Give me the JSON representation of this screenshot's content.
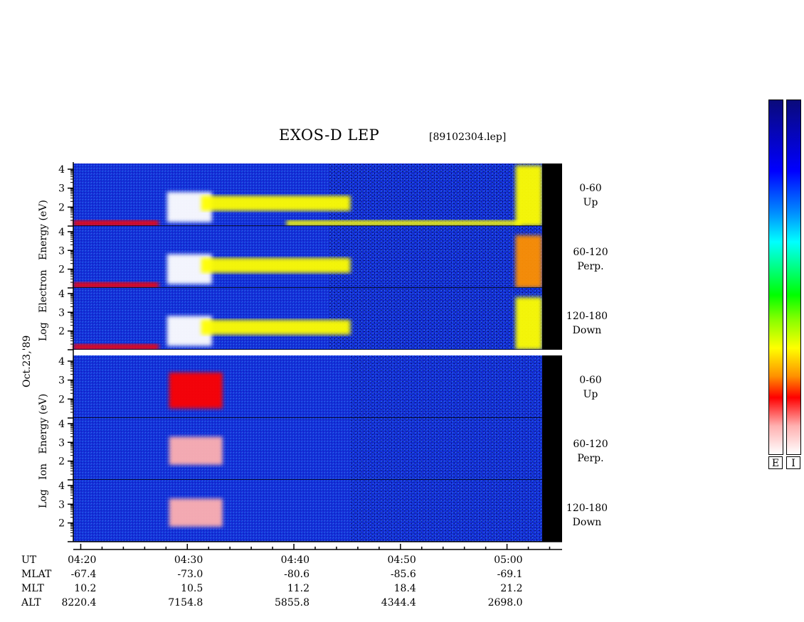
{
  "header": {
    "title": "EXOS-D LEP",
    "file": "[89102304.lep]"
  },
  "y_axis": {
    "date_label": "Oct.23,'89",
    "electron_label": [
      "Log",
      "Electron",
      "Energy",
      "(eV)"
    ],
    "ion_label": [
      "Log",
      "Ion",
      "Energy",
      "(eV)"
    ],
    "ticks": [
      "1",
      "2",
      "3",
      "4"
    ]
  },
  "panels": [
    {
      "group": "electron",
      "angle": "0-60",
      "dir": "Up"
    },
    {
      "group": "electron",
      "angle": "60-120",
      "dir": "Perp."
    },
    {
      "group": "electron",
      "angle": "120-180",
      "dir": "Down"
    },
    {
      "group": "ion",
      "angle": "0-60",
      "dir": "Up"
    },
    {
      "group": "ion",
      "angle": "60-120",
      "dir": "Perp."
    },
    {
      "group": "ion",
      "angle": "120-180",
      "dir": "Down"
    }
  ],
  "footer": {
    "rows": [
      {
        "name": "UT",
        "values": [
          "04:20",
          "04:30",
          "04:40",
          "04:50",
          "05:00"
        ]
      },
      {
        "name": "MLAT",
        "values": [
          "-67.4",
          "-73.0",
          "-80.6",
          "-85.6",
          "-69.1"
        ]
      },
      {
        "name": "MLT",
        "values": [
          "10.2",
          "10.5",
          "11.2",
          "18.4",
          "21.2"
        ]
      },
      {
        "name": "ALT",
        "values": [
          "8220.4",
          "7154.8",
          "5855.8",
          "4344.4",
          "2698.0"
        ]
      }
    ]
  },
  "colorbar": {
    "labels": [
      "E",
      "I"
    ],
    "colors": [
      "#0a0a7a",
      "#0000ff",
      "#0090ff",
      "#00ffff",
      "#00ff00",
      "#ffff00",
      "#ff9000",
      "#ff0000",
      "#ffb0b0",
      "#ffffff"
    ]
  },
  "chart_data": {
    "type": "heatmap",
    "title": "EXOS-D LEP",
    "x": {
      "label": "UT",
      "ticks": [
        "04:20",
        "04:30",
        "04:40",
        "04:50",
        "05:00"
      ],
      "range_minutes": [
        0,
        44
      ]
    },
    "y": {
      "label": "Log Energy (eV)",
      "ticks": [
        1,
        2,
        3,
        4
      ],
      "range": [
        1,
        4.3
      ]
    },
    "features": [
      {
        "panel": 0,
        "t": [
          0,
          8
        ],
        "e": [
          1.0,
          1.3
        ],
        "level": 0.75
      },
      {
        "panel": 0,
        "t": [
          8.8,
          13
        ],
        "e": [
          1.2,
          2.8
        ],
        "level": 0.95
      },
      {
        "panel": 0,
        "t": [
          12,
          26
        ],
        "e": [
          1.8,
          2.6
        ],
        "level": 0.55
      },
      {
        "panel": 0,
        "t": [
          20,
          42
        ],
        "e": [
          1.0,
          1.3
        ],
        "level": 0.55
      },
      {
        "panel": 0,
        "t": [
          41.5,
          44
        ],
        "e": [
          1.0,
          4.2
        ],
        "level": 0.6
      },
      {
        "panel": 1,
        "t": [
          0,
          8
        ],
        "e": [
          1.0,
          1.3
        ],
        "level": 0.75
      },
      {
        "panel": 1,
        "t": [
          8.8,
          13
        ],
        "e": [
          1.2,
          2.8
        ],
        "level": 0.95
      },
      {
        "panel": 1,
        "t": [
          12,
          26
        ],
        "e": [
          1.8,
          2.6
        ],
        "level": 0.55
      },
      {
        "panel": 1,
        "t": [
          41.5,
          44
        ],
        "e": [
          1.0,
          3.8
        ],
        "level": 0.7
      },
      {
        "panel": 2,
        "t": [
          0,
          8
        ],
        "e": [
          1.0,
          1.3
        ],
        "level": 0.75
      },
      {
        "panel": 2,
        "t": [
          8.8,
          13
        ],
        "e": [
          1.2,
          2.8
        ],
        "level": 0.95
      },
      {
        "panel": 2,
        "t": [
          12,
          26
        ],
        "e": [
          1.8,
          2.6
        ],
        "level": 0.55
      },
      {
        "panel": 2,
        "t": [
          41.5,
          44
        ],
        "e": [
          1.0,
          3.8
        ],
        "level": 0.6
      },
      {
        "panel": 3,
        "t": [
          9,
          14
        ],
        "e": [
          1.5,
          3.4
        ],
        "level": 0.75
      },
      {
        "panel": 4,
        "t": [
          9,
          14
        ],
        "e": [
          1.8,
          3.3
        ],
        "level": 0.85
      },
      {
        "panel": 5,
        "t": [
          9,
          14
        ],
        "e": [
          1.8,
          3.3
        ],
        "level": 0.85
      }
    ]
  }
}
